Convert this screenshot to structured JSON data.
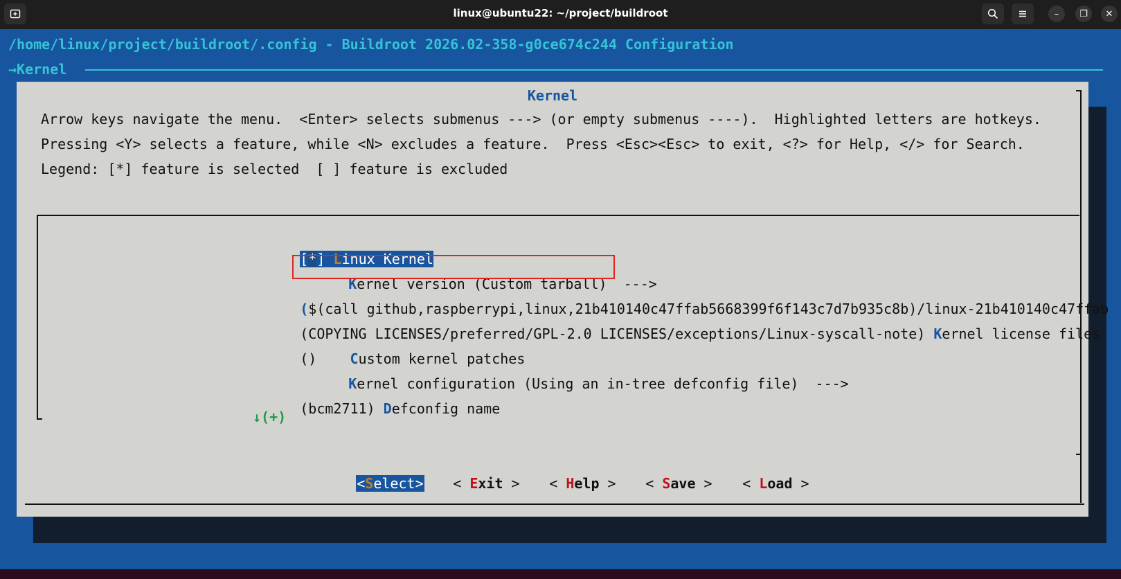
{
  "window": {
    "title": "linux@ubuntu22: ~/project/buildroot",
    "new_tab_icon": "new-tab-icon",
    "search_icon": "search-icon",
    "menu_icon": "hamburger-menu-icon",
    "minimize_glyph": "–",
    "maximize_glyph": "❐",
    "close_glyph": "✕"
  },
  "terminal": {
    "config_path": "/home/linux/project/buildroot/.config - Buildroot 2026.02-358-g0ce674c244 Configuration",
    "breadcrumb": "→Kernel"
  },
  "dialog": {
    "title": "Kernel",
    "help_lines": [
      "Arrow keys navigate the menu.  <Enter> selects submenus ---> (or empty submenus ----).  Highlighted letters are hotkeys.",
      "Pressing <Y> selects a feature, while <N> excludes a feature.  Press <Esc><Esc> to exit, <?> for Help, </> for Search.",
      "Legend: [*] feature is selected  [ ] feature is excluded"
    ]
  },
  "menu": {
    "item1": {
      "bracket_open": "[",
      "mark": "*",
      "bracket_close": "]",
      "hotkey": "L",
      "rest": "inux Kernel"
    },
    "item2": {
      "hotkey": "K",
      "rest": "ernel version (Custom tarball)  --->"
    },
    "item3": {
      "paren": "(",
      "text": "$(call github,raspberrypi,linux,21b410140c47ffab5668399f6f143c7d7b935c8b)/linux-21b410140c47ffab"
    },
    "item4": {
      "prefix": "(COPYING LICENSES/preferred/GPL-2.0 LICENSES/exceptions/Linux-syscall-note) ",
      "hotkey": "K",
      "rest": "ernel license files"
    },
    "item5": {
      "prefix": "()    ",
      "hotkey": "C",
      "rest": "ustom kernel patches"
    },
    "item6": {
      "hotkey": "K",
      "rest": "ernel configuration (Using an in-tree defconfig file)  --->"
    },
    "item7": {
      "prefix": "(bcm2711) ",
      "hotkey": "D",
      "rest": "efconfig name"
    },
    "more_indicator": "↓(+)"
  },
  "buttons": {
    "select": {
      "open": "<",
      "hotkey": "S",
      "rest": "elect",
      "close": ">"
    },
    "exit": {
      "open": "< ",
      "hotkey": "E",
      "rest": "xit",
      "close": " >"
    },
    "help": {
      "open": "< ",
      "hotkey": "H",
      "rest": "elp",
      "close": " >"
    },
    "save": {
      "open": "< ",
      "hotkey": "S",
      "rest": "ave",
      "close": " >"
    },
    "load": {
      "open": "< ",
      "hotkey": "L",
      "rest": "oad",
      "close": " >"
    }
  },
  "colors": {
    "terminal_bg": "#17559f",
    "dialog_bg": "#d3d3cf",
    "cyan_text": "#36c3d6",
    "hotkey_red": "#c0111a",
    "annotation_red": "#e02424",
    "indicator_green": "#1e9c4a"
  }
}
